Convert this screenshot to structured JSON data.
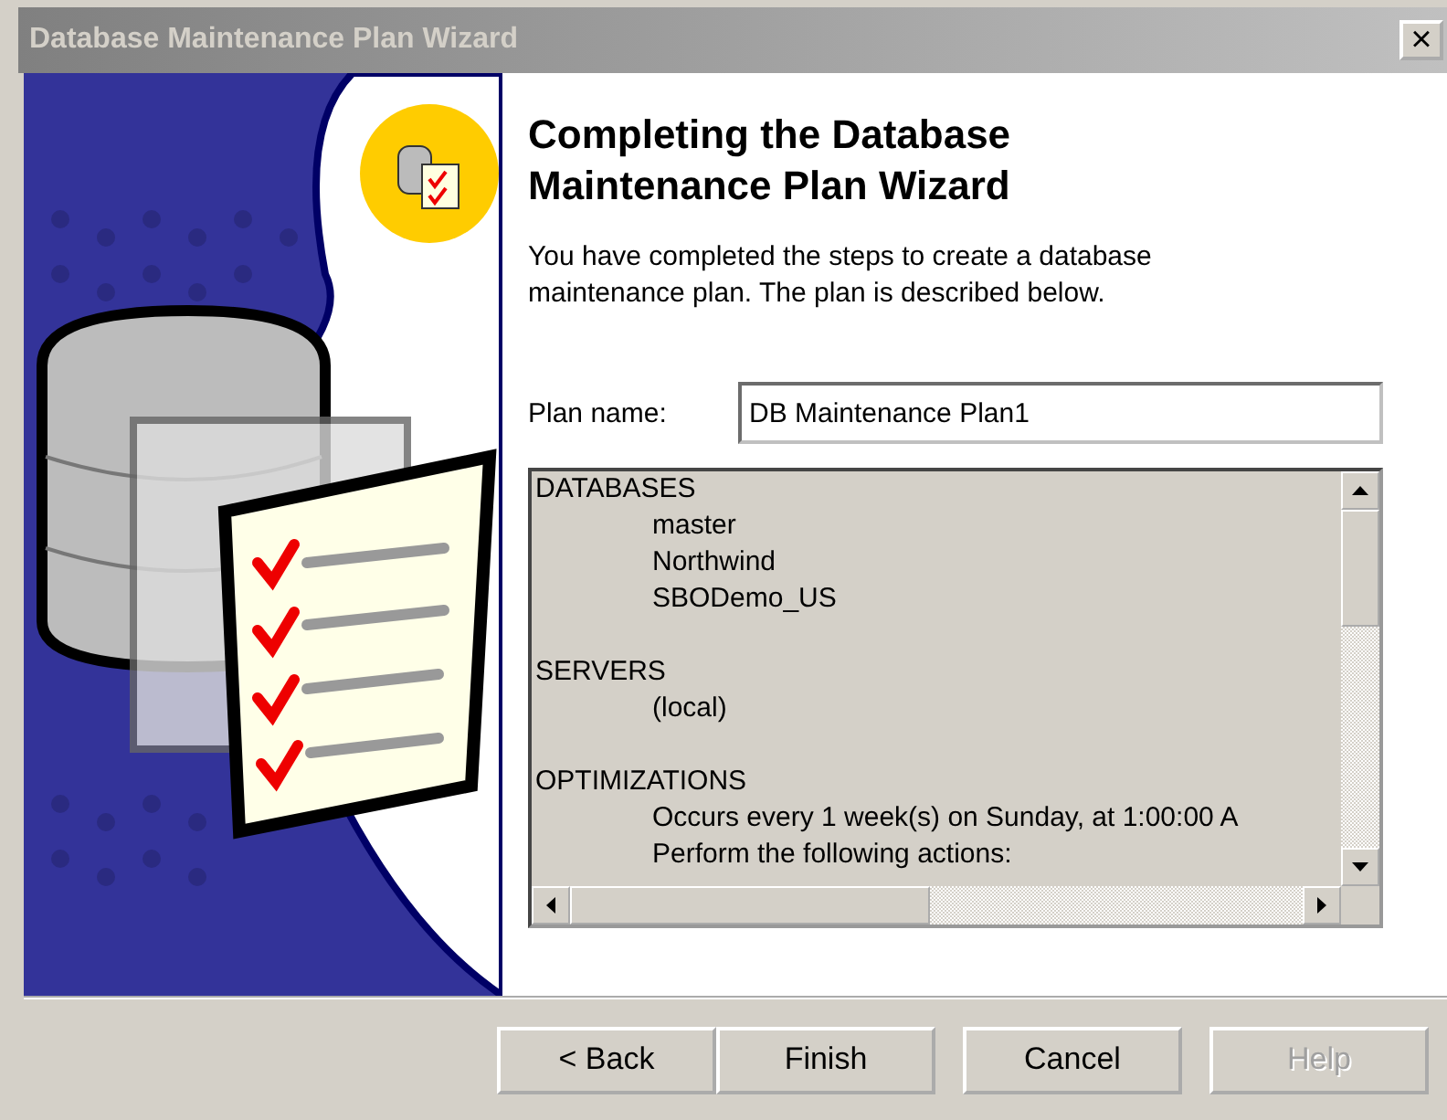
{
  "window": {
    "title": "Database Maintenance Plan Wizard",
    "close": "×"
  },
  "heading": "Completing the Database Maintenance Plan Wizard",
  "description": "You have completed the steps to create a database maintenance plan. The plan is described below.",
  "plan_name": {
    "label": "Plan name:",
    "value": "DB Maintenance Plan1"
  },
  "summary": [
    {
      "heading": "DATABASES",
      "items": [
        "master",
        "Northwind",
        "SBODemo_US"
      ]
    },
    {
      "heading": "SERVERS",
      "items": [
        "(local)"
      ]
    },
    {
      "heading": "OPTIMIZATIONS",
      "items": [
        "Occurs every 1 week(s) on Sunday, at 1:00:00 A",
        "Perform the following actions:"
      ]
    }
  ],
  "buttons": [
    {
      "label": "< Back",
      "disabled": false
    },
    {
      "label": "Finish",
      "disabled": false
    },
    {
      "label": "Cancel",
      "disabled": false
    },
    {
      "label": "Help",
      "disabled": true
    }
  ]
}
